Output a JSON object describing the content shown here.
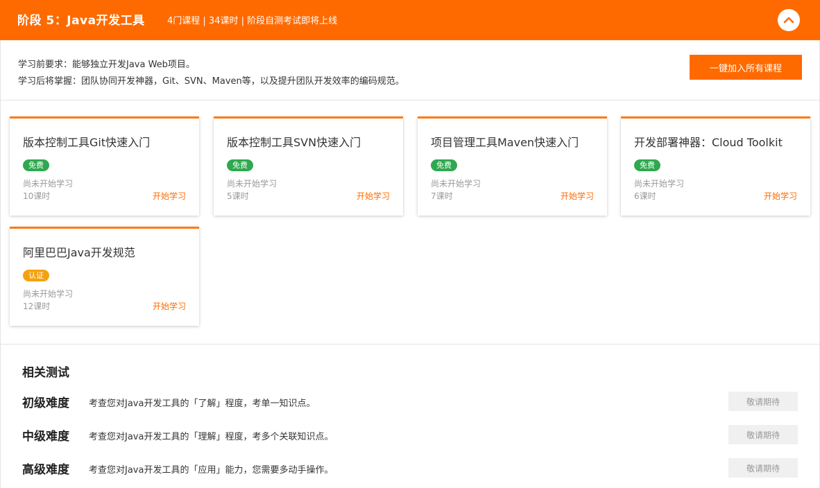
{
  "header": {
    "title": "阶段 5：Java开发工具",
    "meta": "4门课程 | 34课时 | 阶段自测考试即将上线",
    "collapse_icon": "chevron-up-icon"
  },
  "intro": {
    "prerequisite": "学习前要求：能够独立开发Java Web项目。",
    "outcome": "学习后将掌握：团队协同开发神器，Git、SVN、Maven等，以及提升团队开发效率的编码规范。",
    "join_all_label": "一键加入所有课程"
  },
  "courses": [
    {
      "title": "版本控制工具Git快速入门",
      "badge": "免费",
      "badge_type": "free",
      "status": "尚未开始学习",
      "hours": "10课时",
      "action": "开始学习"
    },
    {
      "title": "版本控制工具SVN快速入门",
      "badge": "免费",
      "badge_type": "free",
      "status": "尚未开始学习",
      "hours": "5课时",
      "action": "开始学习"
    },
    {
      "title": "项目管理工具Maven快速入门",
      "badge": "免费",
      "badge_type": "free",
      "status": "尚未开始学习",
      "hours": "7课时",
      "action": "开始学习"
    },
    {
      "title": "开发部署神器：Cloud Toolkit",
      "badge": "免费",
      "badge_type": "free",
      "status": "尚未开始学习",
      "hours": "6课时",
      "action": "开始学习"
    },
    {
      "title": "阿里巴巴Java开发规范",
      "badge": "认证",
      "badge_type": "cert",
      "status": "尚未开始学习",
      "hours": "12课时",
      "action": "开始学习"
    }
  ],
  "tests": {
    "heading": "相关测试",
    "rows": [
      {
        "level": "初级难度",
        "desc": "考查您对Java开发工具的「了解」程度，考单一知识点。",
        "button": "敬请期待"
      },
      {
        "level": "中级难度",
        "desc": "考查您对Java开发工具的「理解」程度，考多个关联知识点。",
        "button": "敬请期待"
      },
      {
        "level": "高级难度",
        "desc": "考查您对Java开发工具的「应用」能力，您需要多动手操作。",
        "button": "敬请期待"
      }
    ]
  },
  "colors": {
    "brand": "#ff6a00",
    "free_badge": "#2fa84f",
    "cert_badge": "#f5a10f"
  }
}
